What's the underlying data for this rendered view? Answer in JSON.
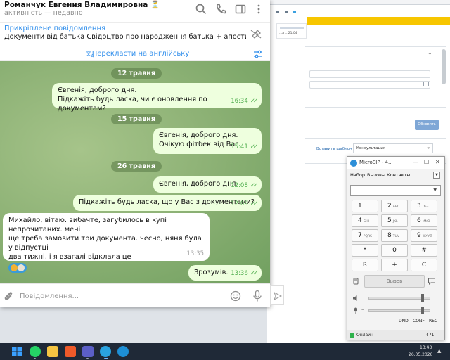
{
  "telegram": {
    "chat_title": "Романчук Евгения Владимировна",
    "chat_status": "активність — недавно",
    "pinned_title": "Прикріплене повідомлення",
    "pinned_text": "Документи від батька  Свідоцтво про народження батька + апостиль Свідо...",
    "translate_label": "Перекласти на англійську",
    "accent_color": "#3390ec",
    "input_placeholder": "Повідомлення...",
    "dates": [
      "12 травня",
      "15 травня",
      "26 травня"
    ],
    "messages": [
      {
        "dir": "out",
        "lines": [
          "Євгенія, доброго дня.",
          "Підкажіть будь ласка, чи є оновлення по документам?"
        ],
        "time": "16:34"
      },
      {
        "dir": "out",
        "lines": [
          "Євгенія, доброго дня.",
          "Очікую фітбек від Вас"
        ],
        "time": "15:41"
      },
      {
        "dir": "out",
        "lines": [
          "Євгенія, доброго дня"
        ],
        "time": "12:08"
      },
      {
        "dir": "out",
        "lines": [
          "Підкажіть будь ласка, що у Вас з документами?"
        ],
        "time": "12:09"
      },
      {
        "dir": "in",
        "lines": [
          "Михайло, вітаю. вибачте, загубилось в купі непрочитаних. мені",
          "ще треба замовити три документа. чесно, няня була у відпустці",
          "два тижні, і я взагалі відклала це"
        ],
        "time": "13:35"
      },
      {
        "dir": "out",
        "lines": [
          "Зрозумів."
        ],
        "time": "13:36"
      }
    ],
    "icons": [
      "search-icon",
      "phone-icon",
      "sidebar-toggle-icon",
      "more-vertical-icon",
      "pin-off-icon",
      "translate-icon",
      "translate-settings-icon",
      "attach-icon",
      "emoji-icon",
      "mic-icon",
      "send-icon"
    ]
  },
  "background_app": {
    "thumb_date": "...а ...21.04",
    "update_button": "Обновить",
    "template_link": "Вставить шаблон",
    "consult_select": "Консультация"
  },
  "microsip": {
    "title": "MicroSIP - 4...",
    "tabs": [
      "Набор",
      "Вызовы",
      "Контакты"
    ],
    "number_value": "",
    "keys": [
      {
        "d": "1",
        "l": ""
      },
      {
        "d": "2",
        "l": "ABC"
      },
      {
        "d": "3",
        "l": "DEF"
      },
      {
        "d": "4",
        "l": "GHI"
      },
      {
        "d": "5",
        "l": "JKL"
      },
      {
        "d": "6",
        "l": "MNO"
      },
      {
        "d": "7",
        "l": "PQRS"
      },
      {
        "d": "8",
        "l": "TUV"
      },
      {
        "d": "9",
        "l": "WXYZ"
      },
      {
        "d": "*",
        "l": ""
      },
      {
        "d": "0",
        "l": ""
      },
      {
        "d": "#",
        "l": ""
      },
      {
        "d": "R",
        "l": ""
      },
      {
        "d": "+",
        "l": ""
      },
      {
        "d": "C",
        "l": ""
      }
    ],
    "call_label": "Вызов",
    "bottom_buttons": [
      "DND",
      "CONF",
      "REC"
    ],
    "status": "Онлайн",
    "extension": "471",
    "status_color": "#2fb24c",
    "speaker_level": 0.85,
    "mic_level": 0.85
  },
  "taskbar": {
    "time": "13:43",
    "date": "26.05.2026",
    "apps": [
      "windows-start-icon",
      "whatsapp-icon",
      "file-explorer-icon",
      "brave-icon",
      "teams-icon",
      "telegram-icon",
      "edge-icon"
    ]
  }
}
